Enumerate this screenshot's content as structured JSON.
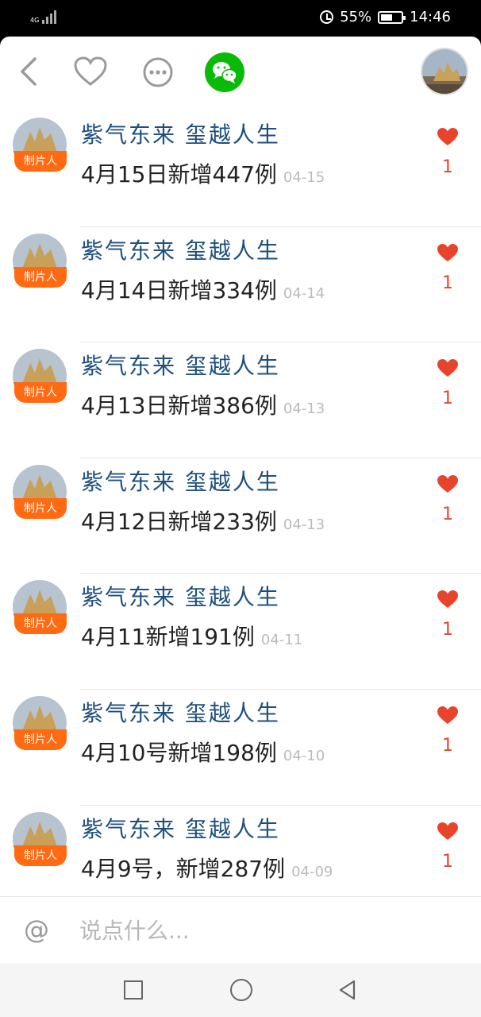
{
  "status_bar": {
    "network": "4G",
    "battery": "55%",
    "time": "14:46"
  },
  "icons": {
    "back": "back-arrow-icon",
    "heart": "heart-outline-icon",
    "more": "more-dots-icon",
    "wechat": "wechat-icon",
    "like": "heart-filled-icon",
    "at": "at-icon"
  },
  "colors": {
    "name": "#1e4f7d",
    "badge": "#ff6a13",
    "like": "#e8442b",
    "wechat": "#09bb07"
  },
  "list": {
    "items": [
      {
        "name": "紫气东来  玺越人生",
        "badge": "制片人",
        "message": "4月15日新增447例",
        "date": "04-15",
        "likes": "1"
      },
      {
        "name": "紫气东来  玺越人生",
        "badge": "制片人",
        "message": "4月14日新增334例",
        "date": "04-14",
        "likes": "1"
      },
      {
        "name": "紫气东来  玺越人生",
        "badge": "制片人",
        "message": "4月13日新增386例",
        "date": "04-13",
        "likes": "1"
      },
      {
        "name": "紫气东来  玺越人生",
        "badge": "制片人",
        "message": "4月12日新增233例",
        "date": "04-13",
        "likes": "1"
      },
      {
        "name": "紫气东来  玺越人生",
        "badge": "制片人",
        "message": "4月11新增191例",
        "date": "04-11",
        "likes": "1"
      },
      {
        "name": "紫气东来  玺越人生",
        "badge": "制片人",
        "message": "4月10号新增198例",
        "date": "04-10",
        "likes": "1"
      },
      {
        "name": "紫气东来  玺越人生",
        "badge": "制片人",
        "message": "4月9号，新增287例",
        "date": "04-09",
        "likes": "1"
      }
    ]
  },
  "comment": {
    "at_symbol": "@",
    "placeholder": "说点什么..."
  }
}
